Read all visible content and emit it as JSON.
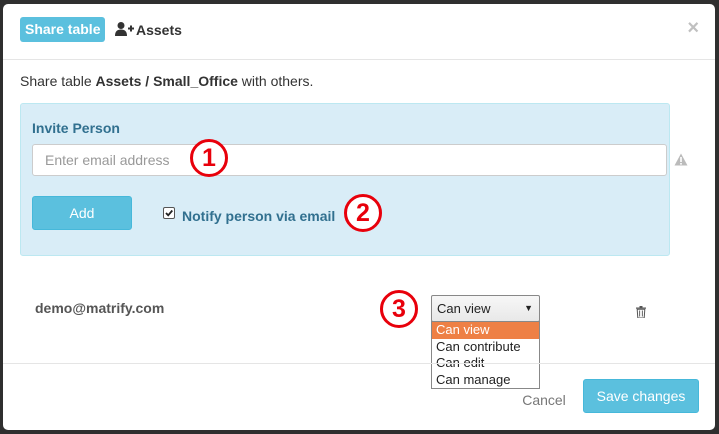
{
  "header": {
    "badge": "Share table",
    "title": "Assets",
    "close_label": "×"
  },
  "intro": {
    "prefix": "Share table ",
    "table_path": "Assets / Small_Office",
    "suffix": " with others."
  },
  "invite": {
    "label": "Invite Person",
    "email_placeholder": "Enter email address",
    "email_value": "",
    "add_label": "Add",
    "notify_label": "Notify person via email",
    "notify_checked": true
  },
  "members": [
    {
      "email": "demo@matrify.com",
      "permission": "Can view",
      "options": [
        "Can view",
        "Can contribute",
        "Can edit",
        "Can manage"
      ],
      "highlighted_option": "Can view"
    }
  ],
  "footer": {
    "cancel_label": "Cancel",
    "save_label": "Save changes"
  },
  "markers": [
    "1",
    "2",
    "3"
  ],
  "colors": {
    "accent": "#5bc0de",
    "panel_bg": "#d9edf7",
    "label_text": "#31708f",
    "option_highlight": "#ee8045",
    "marker_red": "#e8000b"
  },
  "icons": {
    "title": "user-plus-icon",
    "warning": "warning-icon",
    "delete": "trash-icon",
    "close": "close-icon"
  }
}
